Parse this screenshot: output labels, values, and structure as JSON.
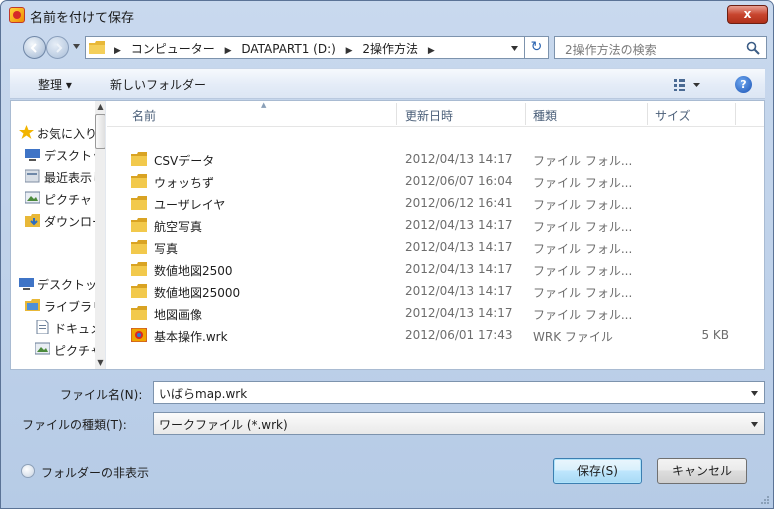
{
  "window": {
    "title": "名前を付けて保存",
    "close_label": "x"
  },
  "address": {
    "crumbs": [
      "コンピューター",
      "DATAPART1 (D:)",
      "2操作方法"
    ],
    "search_placeholder": "2操作方法の検索"
  },
  "toolbar": {
    "organize_label": "整理 ▾",
    "new_folder_label": "新しいフォルダー"
  },
  "nav": {
    "items": [
      {
        "label": "お気に入り",
        "icon": "star-icon"
      },
      {
        "label": "デスクトップ",
        "icon": "desktop-icon"
      },
      {
        "label": "最近表示した場所",
        "icon": "recent-places-icon"
      },
      {
        "label": "ピクチャ",
        "icon": "pictures-icon"
      },
      {
        "label": "ダウンロード",
        "icon": "downloads-icon"
      },
      {
        "label": "デスクトップ",
        "icon": "desktop-icon"
      },
      {
        "label": "ライブラリ",
        "icon": "library-icon"
      },
      {
        "label": "ドキュメント",
        "icon": "document-icon"
      },
      {
        "label": "ピクチャ",
        "icon": "pictures-icon"
      }
    ]
  },
  "columns": {
    "name": "名前",
    "date": "更新日時",
    "type": "種類",
    "size": "サイズ"
  },
  "files": [
    {
      "name": "CSVデータ",
      "date": "2012/04/13 14:17",
      "type": "ファイル フォル...",
      "size": "",
      "icon": "folder-icon"
    },
    {
      "name": "ウォッちず",
      "date": "2012/06/07 16:04",
      "type": "ファイル フォル...",
      "size": "",
      "icon": "folder-icon"
    },
    {
      "name": "ユーザレイヤ",
      "date": "2012/06/12 16:41",
      "type": "ファイル フォル...",
      "size": "",
      "icon": "folder-icon"
    },
    {
      "name": "航空写真",
      "date": "2012/04/13 14:17",
      "type": "ファイル フォル...",
      "size": "",
      "icon": "folder-icon"
    },
    {
      "name": "写真",
      "date": "2012/04/13 14:17",
      "type": "ファイル フォル...",
      "size": "",
      "icon": "folder-icon"
    },
    {
      "name": "数値地図2500",
      "date": "2012/04/13 14:17",
      "type": "ファイル フォル...",
      "size": "",
      "icon": "folder-icon"
    },
    {
      "name": "数値地図25000",
      "date": "2012/04/13 14:17",
      "type": "ファイル フォル...",
      "size": "",
      "icon": "folder-icon"
    },
    {
      "name": "地図画像",
      "date": "2012/04/13 14:17",
      "type": "ファイル フォル...",
      "size": "",
      "icon": "folder-icon"
    },
    {
      "name": "基本操作.wrk",
      "date": "2012/06/01 17:43",
      "type": "WRK ファイル",
      "size": "5 KB",
      "icon": "wrk-file-icon"
    }
  ],
  "form": {
    "filename_label": "ファイル名(N):",
    "filename_value": "いばらmap.wrk",
    "filetype_label": "ファイルの種類(T):",
    "filetype_value": "ワークファイル (*.wrk)"
  },
  "footer": {
    "hide_folders_label": "フォルダーの非表示",
    "save_label": "保存(S)",
    "cancel_label": "キャンセル"
  },
  "colors": {
    "window_frame": "#b6cbe6",
    "folder": "#e8b838",
    "close_button": "#c8452e"
  }
}
